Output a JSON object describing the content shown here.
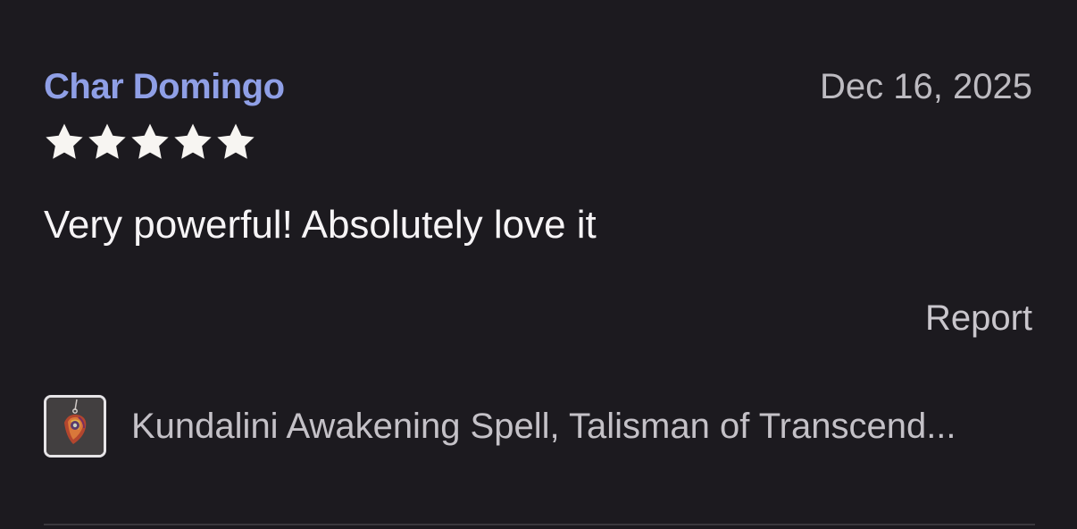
{
  "review": {
    "reviewer_name": "Char Domingo",
    "date": "Dec 16, 2025",
    "rating": 5,
    "rating_max": 5,
    "text": "Very powerful! Absolutely love it",
    "report_label": "Report"
  },
  "listing": {
    "title": "Kundalini Awakening Spell, Talisman of Transcend...",
    "thumbnail_icon": "pendant-thumbnail"
  },
  "colors": {
    "background": "#1c1a1f",
    "reviewer_name": "#8f9fe6",
    "star": "#f7f5f2",
    "muted_text": "#bdbbc1"
  }
}
